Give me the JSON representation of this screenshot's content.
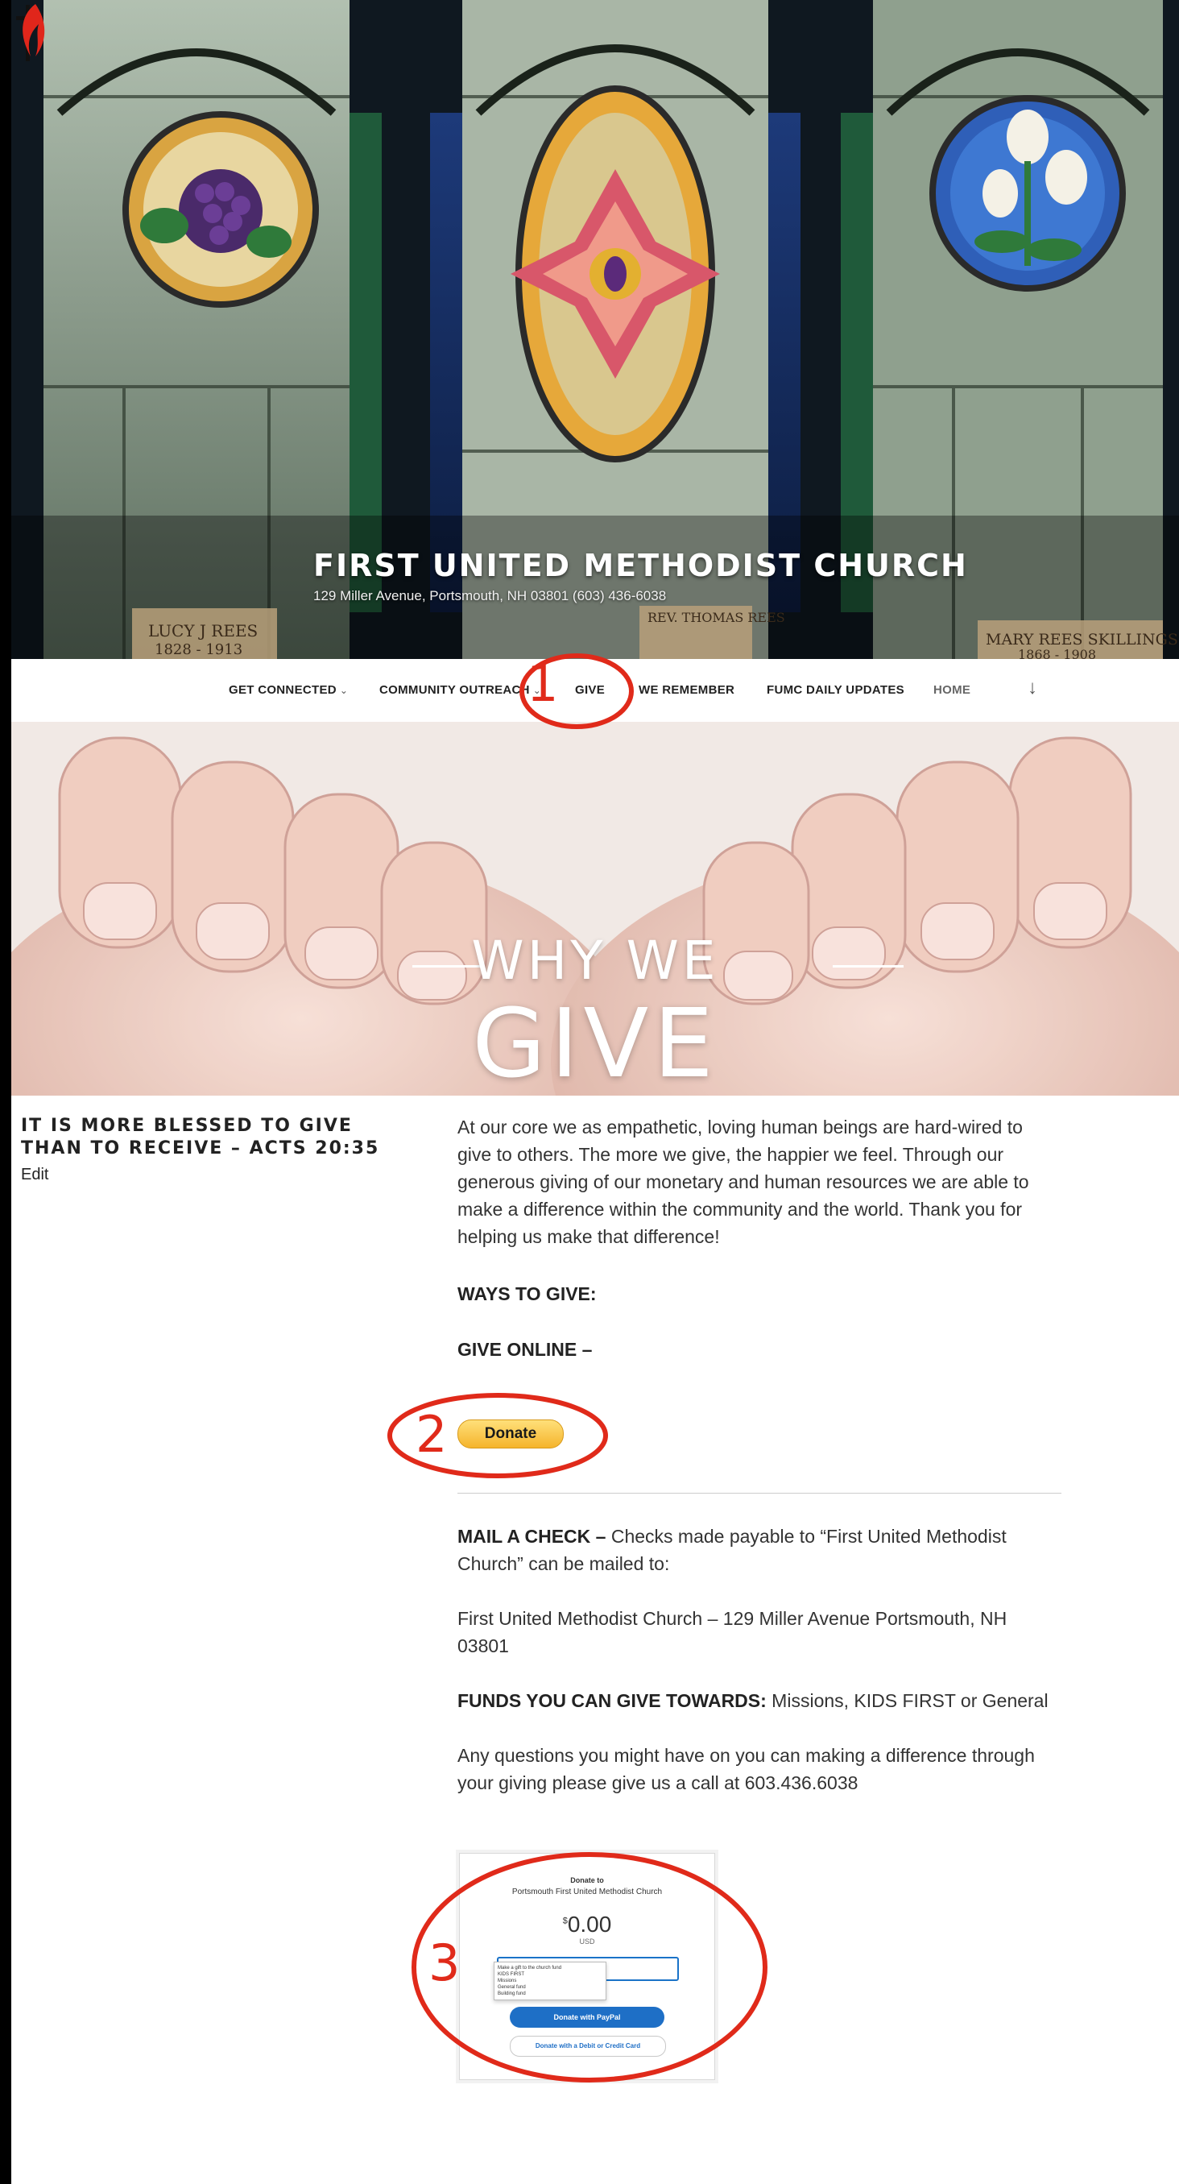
{
  "header": {
    "site_title": "FIRST UNITED METHODIST CHURCH",
    "site_description": "129 Miller Avenue, Portsmouth, NH 03801 (603) 436-6038",
    "window_inscriptions": [
      "LUCY J REES",
      "1828 - 1913",
      "REV. THOMAS REES",
      "MARY REES SKILLINGS",
      "1868 - 1908"
    ]
  },
  "nav": {
    "items": [
      {
        "label": "GET CONNECTED",
        "has_submenu": true
      },
      {
        "label": "COMMUNITY OUTREACH",
        "has_submenu": true
      },
      {
        "label": "GIVE",
        "has_submenu": false
      },
      {
        "label": "WE REMEMBER",
        "has_submenu": false
      },
      {
        "label": "FUMC DAILY UPDATES",
        "has_submenu": false
      },
      {
        "label": "HOME",
        "has_submenu": false
      }
    ],
    "chevron": "⌄",
    "scroll_arrow": "↓"
  },
  "hero": {
    "line1": "WHY WE",
    "line2": "GIVE"
  },
  "sidebar": {
    "title": "IT IS MORE BLESSED TO GIVE THAN TO RECEIVE – ACTS 20:35",
    "edit_label": "Edit"
  },
  "content": {
    "intro": "At our core we as empathetic, loving human beings are hard-wired to give to others. The more we give, the happier we feel. Through our generous giving of our monetary and human resources we are able to make a difference within the community and the world.   Thank you for helping us make that difference!",
    "ways_heading": "WAYS TO GIVE:",
    "online_heading": "GIVE ONLINE –",
    "donate_label": "Donate",
    "mail_heading": "MAIL A CHECK –",
    "mail_text": " Checks made payable to “First United Methodist Church” can be mailed to:",
    "address": "First United Methodist Church – 129 Miller Avenue Portsmouth, NH 03801",
    "funds_heading": "FUNDS YOU CAN GIVE TOWARDS:",
    "funds_text": " Missions, KIDS FIRST or General",
    "questions": "Any questions you might have on you can making a difference through your giving please give us a call at 603.436.6038"
  },
  "paypal": {
    "donate_to": "Donate to",
    "org": "Portsmouth First United Methodist Church",
    "currency_symbol": "$",
    "amount": "0.00",
    "currency": "USD",
    "options": [
      "Make a gift to the church fund",
      "KIDS FIRST",
      "Missions",
      "General fund",
      "Building fund"
    ],
    "paypal_button": "Donate with PayPal",
    "card_button": "Donate with a Debit or Credit Card"
  },
  "annotations": {
    "one": "1",
    "two": "2",
    "three": "3",
    "color": "#e02a1a"
  },
  "colors": {
    "nav_text": "#222222",
    "donate_button": "#f5b42c",
    "paypal_blue": "#1e6fc6"
  }
}
